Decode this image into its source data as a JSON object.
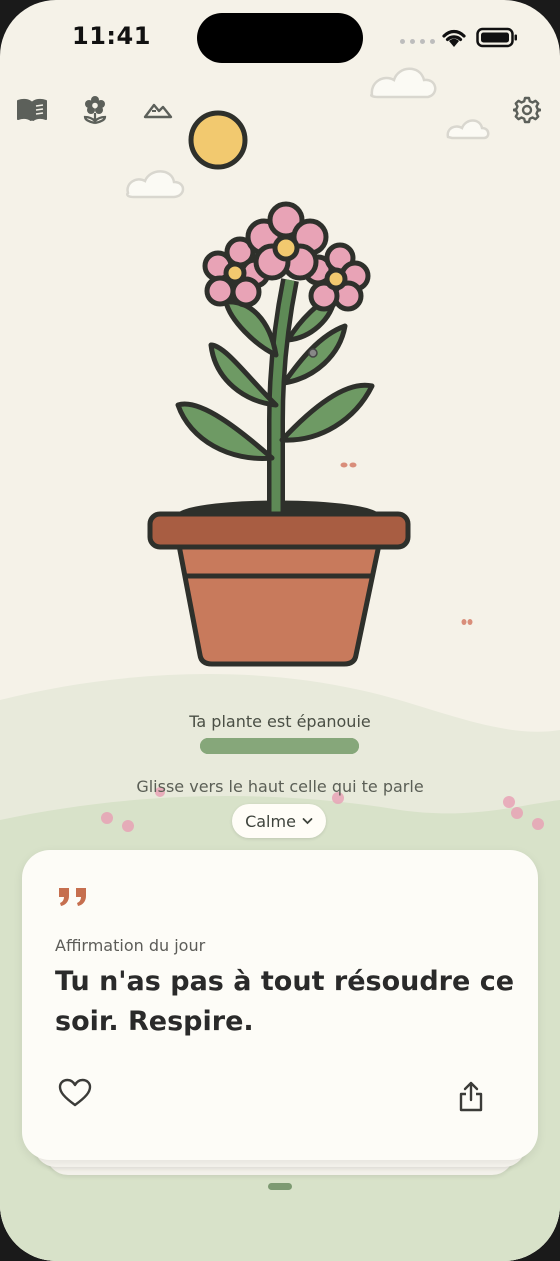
{
  "status_bar": {
    "time": "11:41"
  },
  "toolbar": {
    "icons": [
      "journal-icon",
      "flower-icon",
      "mountain-icon",
      "settings-icon"
    ]
  },
  "plant": {
    "status_label": "Ta plante est épanouie",
    "progress": 1.0
  },
  "swipe_hint": "Glisse vers le haut celle qui te parle",
  "mood_selector": {
    "selected": "Calme"
  },
  "affirmation_card": {
    "label": "Affirmation du jour",
    "text": "Tu n'as pas à tout résoudre ce soir. Respire."
  },
  "colors": {
    "background": "#f5f2e8",
    "accent_green": "#86a77a",
    "pot": "#c87a5c",
    "petal": "#e8a3b6",
    "sun": "#f2c96f",
    "quote": "#c66f4f"
  }
}
